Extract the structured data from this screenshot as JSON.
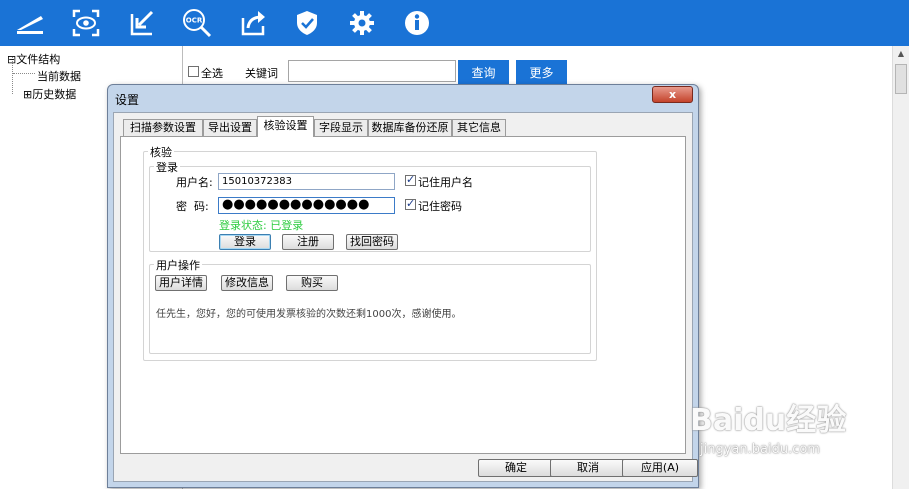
{
  "toolbar": {
    "icons": [
      "scan-icon",
      "eye-icon",
      "import-icon",
      "ocr-search-icon",
      "export-icon",
      "shield-check-icon",
      "gear-icon",
      "info-icon"
    ],
    "ocr_text": "OCR",
    "accent": "#1a73d6"
  },
  "tree": {
    "root": {
      "expander": "⊟",
      "label": "文件结构"
    },
    "items": [
      {
        "label": "当前数据"
      },
      {
        "expander": "⊞",
        "label": "历史数据"
      }
    ]
  },
  "search": {
    "select_all_label": "全选",
    "keyword_label": "关键词",
    "keyword_value": "",
    "query_button": "查询",
    "more_button": "更多"
  },
  "dialog": {
    "title": "设置",
    "close_symbol": "x",
    "tabs": [
      {
        "label": "扫描参数设置",
        "active": false
      },
      {
        "label": "导出设置",
        "active": false
      },
      {
        "label": "核验设置",
        "active": true
      },
      {
        "label": "字段显示",
        "active": false
      },
      {
        "label": "数据库备份还原",
        "active": false
      },
      {
        "label": "其它信息",
        "active": false
      }
    ],
    "verify_group": "核验",
    "login_group": "登录",
    "username_label": "用户名:",
    "username_value": "15010372383",
    "remember_user_label": "记住用户名",
    "remember_user_checked": true,
    "password_label": "密  码:",
    "password_value": "●●●●●●●●●●●●●",
    "remember_pw_label": "记住密码",
    "remember_pw_checked": true,
    "login_status": "登录状态: 已登录",
    "login_button": "登录",
    "register_button": "注册",
    "recover_button": "找回密码",
    "user_ops_group": "用户操作",
    "user_detail_button": "用户详情",
    "edit_info_button": "修改信息",
    "buy_button": "购买",
    "info_text": "任先生，您好，您的可使用发票核验的次数还剩1000次，感谢使用。",
    "ok_button": "确定",
    "cancel_button": "取消",
    "apply_button": "应用(A)"
  },
  "watermark": {
    "logo": "Baidu经验",
    "url": "jingyan.baidu.com"
  }
}
